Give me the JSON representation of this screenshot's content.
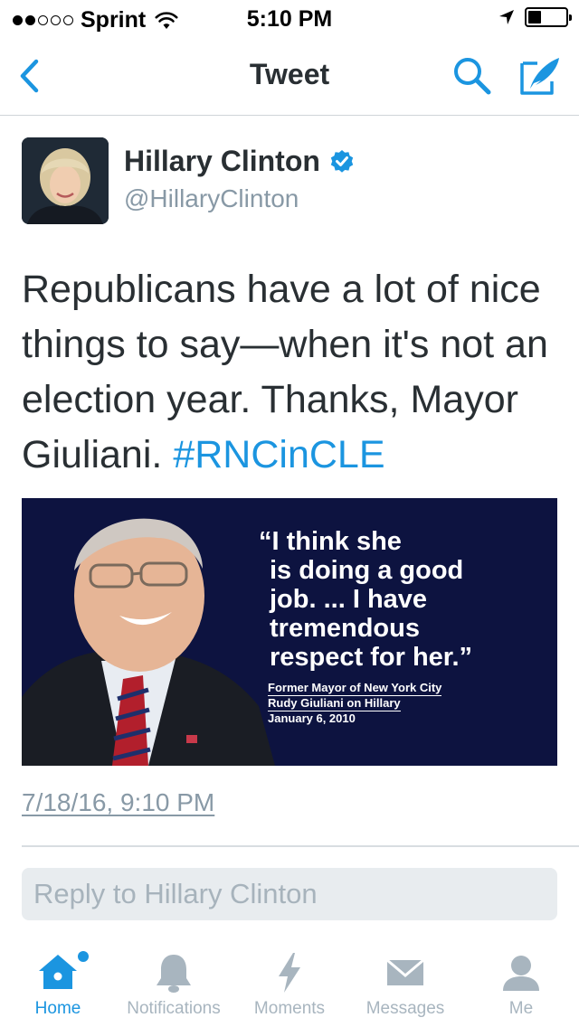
{
  "status_bar": {
    "signal_dots_total": 5,
    "signal_dots_filled": 2,
    "carrier": "Sprint",
    "time": "5:10 PM",
    "battery_level": 0.35,
    "icons": [
      "wifi-icon",
      "location-arrow-icon",
      "battery-icon"
    ]
  },
  "nav": {
    "title": "Tweet",
    "icons": [
      "back-chevron-icon",
      "search-icon",
      "compose-icon"
    ],
    "accent_color": "#1b95e0"
  },
  "tweet": {
    "author_name": "Hillary Clinton",
    "author_handle": "@HillaryClinton",
    "verified": true,
    "text": "Republicans have a lot of nice things to say—when it's not an election year. Thanks, Mayor Giuliani.",
    "hashtag": "#RNCinCLE",
    "timestamp": "7/18/16, 9:10 PM"
  },
  "media": {
    "quote_lines": [
      "“I think she",
      "is doing a good",
      "job. ... I have",
      "tremendous",
      "respect for her.”"
    ],
    "attribution_lines": [
      "Former Mayor of New York City",
      "Rudy Giuliani on Hillary",
      "January 6, 2010"
    ],
    "background_color": "#0d1340"
  },
  "reply": {
    "placeholder": "Reply to Hillary Clinton"
  },
  "tabs": [
    {
      "label": "Home",
      "icon": "home-icon",
      "active": true
    },
    {
      "label": "Notifications",
      "icon": "bell-icon",
      "active": false
    },
    {
      "label": "Moments",
      "icon": "lightning-icon",
      "active": false
    },
    {
      "label": "Messages",
      "icon": "envelope-icon",
      "active": false
    },
    {
      "label": "Me",
      "icon": "person-icon",
      "active": false
    }
  ],
  "colors": {
    "link": "#1b95e0",
    "secondary_text": "#8899a6",
    "primary_text": "#292f33",
    "inactive_tab": "#a8b5bf"
  }
}
